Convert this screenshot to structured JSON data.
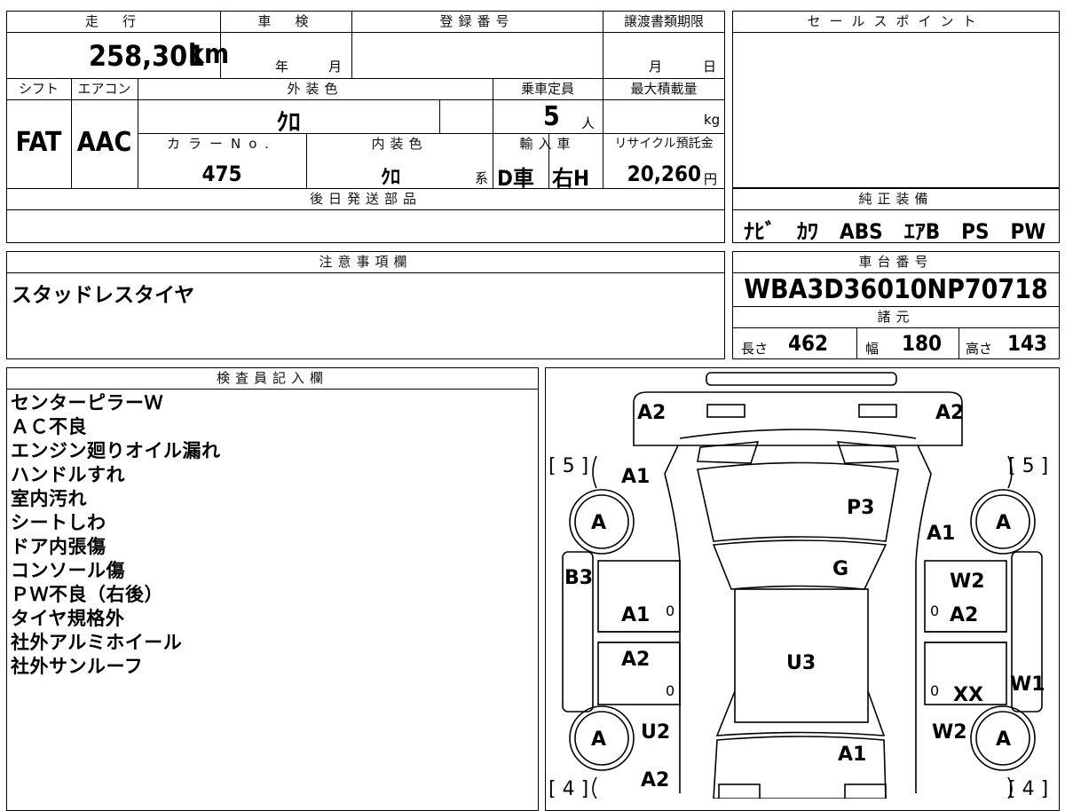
{
  "headers": {
    "mileage": "走　行",
    "inspection": "車　検",
    "registration": "登録番号",
    "transfer_deadline": "譲渡書類期限",
    "sales_point": "セールスポイント",
    "shift": "シフト",
    "aircon": "エアコン",
    "exterior_color": "外装色",
    "capacity": "乗車定員",
    "max_load": "最大積載量",
    "color_no": "カラーNo.",
    "interior_color": "内装色",
    "import": "輸入車",
    "recycle": "リサイクル預託金",
    "later_parts": "後日発送部品",
    "genuine_equipment": "純正装備",
    "notes": "注意事項欄",
    "chassis_no": "車台番号",
    "specs": "諸元",
    "inspector": "検査員記入欄"
  },
  "vehicle": {
    "mileage_value": "258,301",
    "mileage_unit": "km",
    "inspection_year_unit": "年",
    "inspection_month_unit": "月",
    "deadline_month_unit": "月",
    "deadline_day_unit": "日",
    "shift_value": "FAT",
    "aircon_value": "AAC",
    "exterior_color_value": "ｸﾛ",
    "capacity_value": "5",
    "capacity_unit": "人",
    "max_load_unit": "kg",
    "color_no_value": "475",
    "interior_color_value": "ｸﾛ",
    "interior_suffix": "系",
    "import_type": "D車",
    "handle": "右H",
    "recycle_value": "20,260",
    "recycle_unit": "円",
    "equipment": "ﾅﾋﾞ　ｶﾜ　ABS　ｴｱB　PS　PW",
    "notes_text": "スタッドレスタイヤ",
    "chassis_no_value": "WBA3D36010NP70718",
    "length_label": "長さ",
    "length_value": "462",
    "width_label": "幅",
    "width_value": "180",
    "height_label": "高さ",
    "height_value": "143"
  },
  "inspector_notes": [
    "センターピラーＷ",
    "ＡＣ不良",
    "エンジン廻りオイル漏れ",
    "ハンドルすれ",
    "室内汚れ",
    "シートしわ",
    "ドア内張傷",
    "コンソール傷",
    "ＰＷ不良（右後）",
    "タイヤ規格外",
    "社外アルミホイール",
    "社外サンルーフ"
  ],
  "diagram": {
    "tire_marks": {
      "front_left": "[ 5 ]",
      "front_right": "[ 5 ]",
      "rear_left": "[ 4 ]",
      "rear_right": "[ 4 ]"
    },
    "wheel_label": "A",
    "zero": "0",
    "damage_codes": {
      "front_bumper_left": "A2",
      "front_bumper_right": "A2",
      "front_fender_left": "A1",
      "hood": "P3",
      "front_fender_right": "A1",
      "windshield": "G",
      "front_pillar_left": "B3",
      "front_door_right_top": "W2",
      "front_door_left": "A1",
      "front_door_right": "A2",
      "roof": "U3",
      "rear_door_left": "A2",
      "rocker_right": "W1",
      "rear_door_right": "XX",
      "rear_fender_left": "U2",
      "rear_fender_right": "W2",
      "trunk": "A1",
      "rear_bumper_left": "A2"
    }
  }
}
